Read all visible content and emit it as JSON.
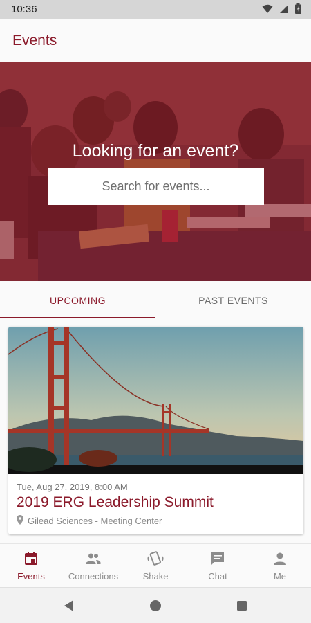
{
  "status_bar": {
    "time": "10:36"
  },
  "app_bar": {
    "title": "Events"
  },
  "hero": {
    "heading": "Looking for an event?",
    "search_placeholder": "Search for events..."
  },
  "tabs": [
    {
      "label": "UPCOMING",
      "active": true
    },
    {
      "label": "PAST EVENTS",
      "active": false
    }
  ],
  "events": [
    {
      "date": "Tue, Aug 27, 2019, 8:00 AM",
      "title": "2019 ERG Leadership Summit",
      "location": "Gilead Sciences - Meeting Center"
    }
  ],
  "bottom_nav": [
    {
      "label": "Events",
      "icon": "calendar-icon",
      "active": true
    },
    {
      "label": "Connections",
      "icon": "people-icon",
      "active": false
    },
    {
      "label": "Shake",
      "icon": "shake-icon",
      "active": false
    },
    {
      "label": "Chat",
      "icon": "chat-icon",
      "active": false
    },
    {
      "label": "Me",
      "icon": "person-icon",
      "active": false
    }
  ],
  "colors": {
    "brand": "#8b1a2b",
    "inactive": "#8c8c8c"
  }
}
